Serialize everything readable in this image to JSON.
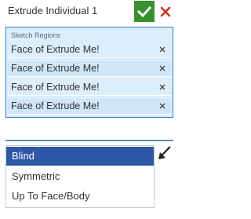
{
  "dialog": {
    "title": "Extrude Individual 1",
    "accept_icon": "check-icon",
    "cancel_icon": "close-icon",
    "accept_color": "#3a8f2f",
    "cancel_color": "#c0392b"
  },
  "sketch_regions": {
    "label": "Sketch Regions",
    "items": [
      {
        "label": "Face of Extrude Me!",
        "remove_icon": "close-icon"
      },
      {
        "label": "Face of Extrude Me!",
        "remove_icon": "close-icon"
      },
      {
        "label": "Face of Extrude Me!",
        "remove_icon": "close-icon"
      },
      {
        "label": "Face of Extrude Me!",
        "remove_icon": "close-icon"
      }
    ]
  },
  "end_type": {
    "options": [
      "Blind",
      "Symmetric",
      "Up To Face/Body"
    ],
    "selected": "Blind",
    "flip_icon": "flip-direction-arrow-icon"
  },
  "colors": {
    "selection_accent": "#2e7bd8",
    "selected_option_bg": "#2f57a8",
    "region_bg": "#dceefb"
  }
}
